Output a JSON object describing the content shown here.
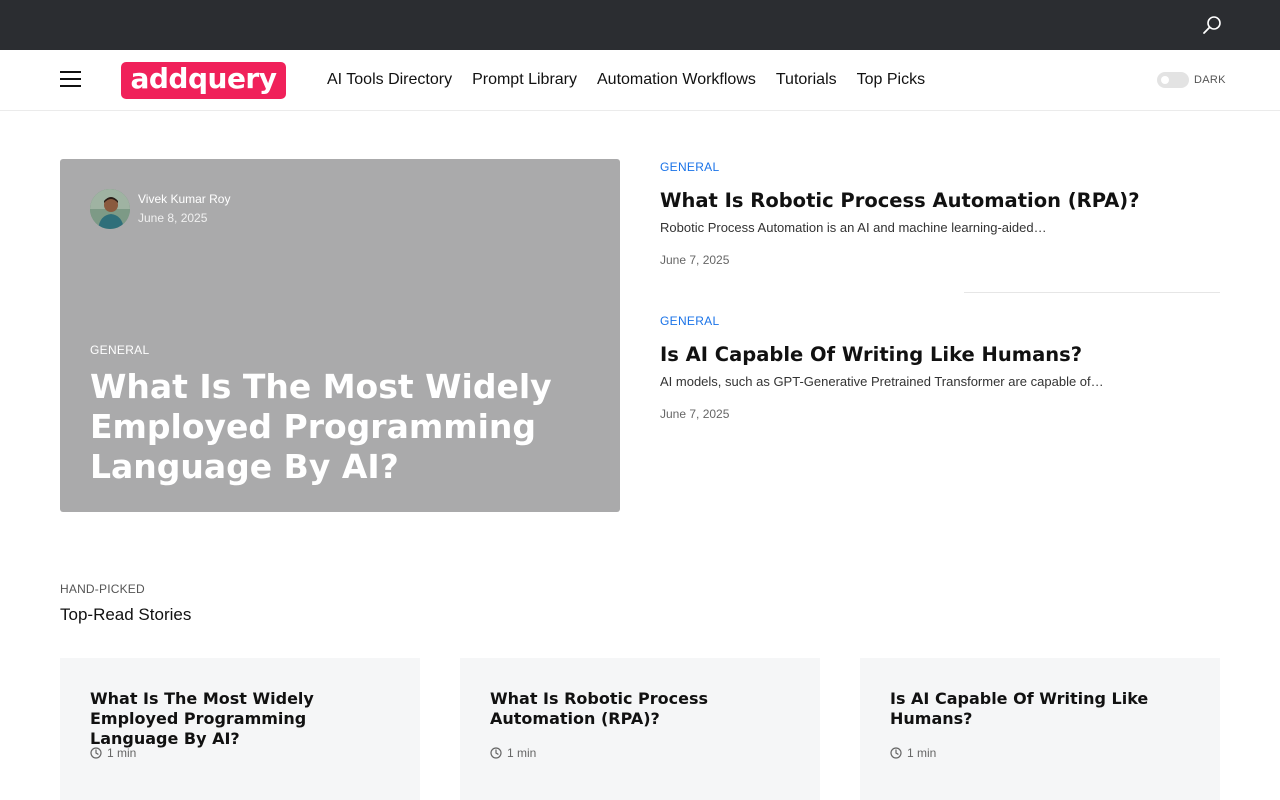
{
  "topbar": {
    "search_icon": "search-icon"
  },
  "header": {
    "logo_text": "addquery",
    "brand_color": "#f0215a",
    "nav": [
      "AI Tools Directory",
      "Prompt Library",
      "Automation Workflows",
      "Tutorials",
      "Top Picks"
    ],
    "dark_label": "DARK"
  },
  "featured": {
    "author": "Vivek Kumar Roy",
    "date": "June 8, 2025",
    "category": "GENERAL",
    "title": "What Is The Most Widely Employed Programming Language By AI?"
  },
  "side_posts": [
    {
      "category": "GENERAL",
      "title": "What Is Robotic Process Automation (RPA)?",
      "excerpt": "Robotic Process Automation is an AI and machine learning-aided…",
      "date": "June 7, 2025"
    },
    {
      "category": "GENERAL",
      "title": "Is AI Capable Of Writing Like Humans?",
      "excerpt": "AI models, such as GPT-Generative Pretrained Transformer are capable of…",
      "date": "June 7, 2025"
    }
  ],
  "hand_picked": {
    "kicker": "HAND-PICKED",
    "title": "Top-Read Stories",
    "cards": [
      {
        "title": "What Is The Most Widely Employed Programming Language By AI?",
        "read_time": "1 min"
      },
      {
        "title": "What Is Robotic Process Automation (RPA)?",
        "read_time": "1 min"
      },
      {
        "title": "Is AI Capable Of Writing Like Humans?",
        "read_time": "1 min"
      }
    ]
  }
}
